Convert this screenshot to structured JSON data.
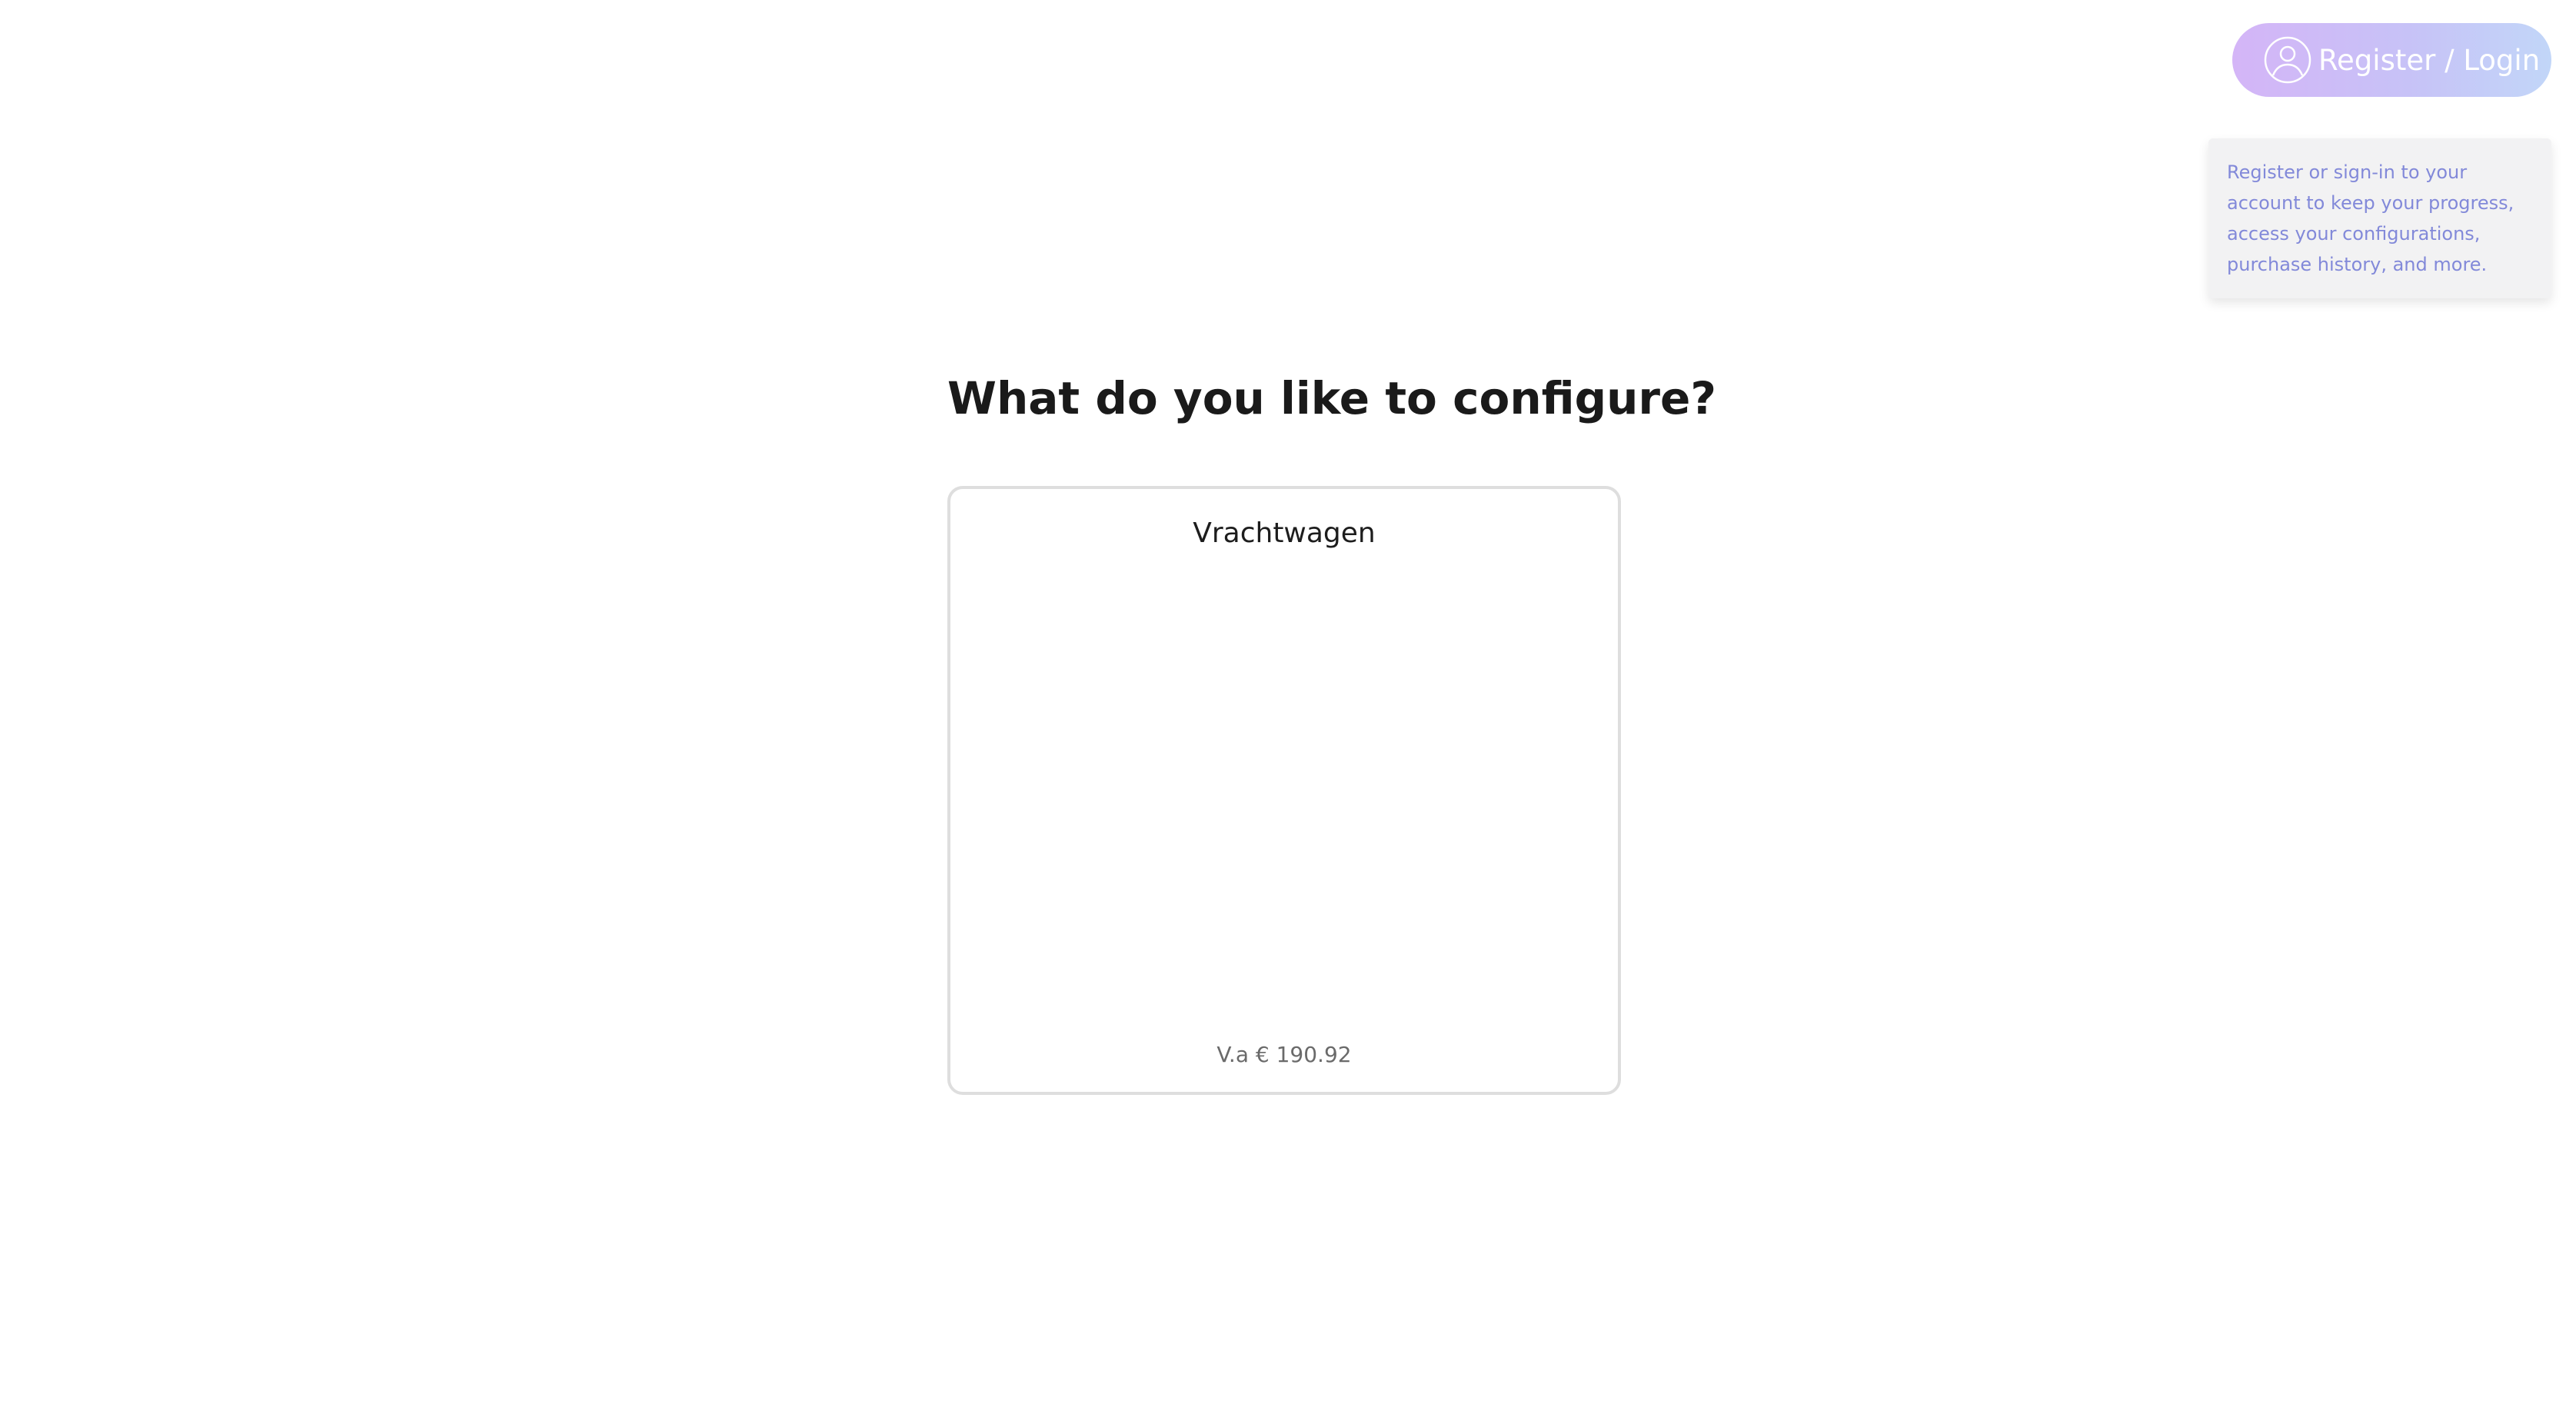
{
  "header": {
    "login_button": {
      "label": "Register / Login",
      "icon": "user-circle-icon",
      "gradient": [
        "#d4b5f7",
        "#c2d6f8"
      ]
    },
    "tooltip": {
      "text": "Register or sign-in to your account to keep your progress, access your configurations, purchase history, and more.",
      "text_color": "#8289d9"
    }
  },
  "main": {
    "title": "What do you like to configure?",
    "products": [
      {
        "name": "Vrachtwagen",
        "price": "V.a € 190.92"
      }
    ]
  }
}
